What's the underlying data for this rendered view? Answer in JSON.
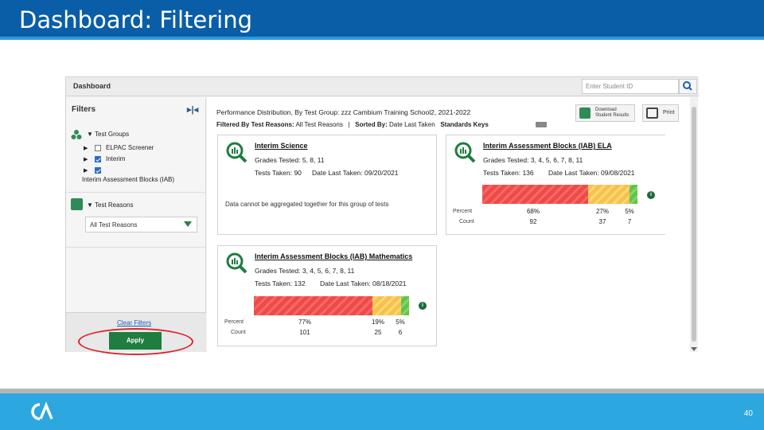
{
  "slide": {
    "title": "Dashboard: Filtering",
    "page_number": "40",
    "colors": {
      "header": "#0a5ea8",
      "footer": "#2ca7e0",
      "apply": "#1e7d3f",
      "highlight": "#d8272c"
    }
  },
  "app": {
    "title": "Dashboard",
    "search_placeholder": "Enter Student ID",
    "search_icon": "search-icon"
  },
  "filters": {
    "label": "Filters",
    "test_groups_label": "Test Groups",
    "groups": [
      {
        "label": "ELPAC Screener",
        "checked": false
      },
      {
        "label": "Interim",
        "checked": true
      },
      {
        "label": "",
        "checked": true
      }
    ],
    "iab_label": "Interim Assessment Blocks (IAB)",
    "test_reasons_label": "Test Reasons",
    "test_reasons_value": "All Test Reasons",
    "clear_link": "Clear Filters",
    "apply_button": "Apply"
  },
  "main": {
    "title": "Performance Distribution, By Test Group: zzz Cambium Training School2, 2021-2022",
    "filtered_by_label": "Filtered By Test Reasons:",
    "filtered_by_value": "All Test Reasons",
    "separator": "|",
    "sorted_by_label": "Sorted By:",
    "sorted_by_value": "Date Last Taken",
    "standards_keys": "Standards Keys",
    "download_line1": "Download",
    "download_line2": "Student Results",
    "print": "Print"
  },
  "cards": [
    {
      "title": "Interim Science",
      "grades": "Grades Tested: 5, 8, 11",
      "tests_taken": "Tests Taken: 90",
      "date_last": "Date Last Taken: 09/20/2021",
      "message": "Data cannot be aggregated together for this group of tests"
    },
    {
      "title": "Interim Assessment Blocks (IAB) ELA",
      "grades": "Grades Tested: 3, 4, 5, 6, 7, 8, 11",
      "tests_taken": "Tests Taken: 136",
      "date_last": "Date Last Taken: 09/08/2021",
      "percent_label": "Percent",
      "count_label": "Count",
      "distribution": [
        {
          "percent": "68%",
          "count": "92",
          "share": 0.68
        },
        {
          "percent": "27%",
          "count": "37",
          "share": 0.27
        },
        {
          "percent": "5%",
          "count": "7",
          "share": 0.05
        }
      ]
    },
    {
      "title": "Interim Assessment Blocks (IAB) Mathematics",
      "grades": "Grades Tested: 3, 4, 5, 6, 7, 8, 11",
      "tests_taken": "Tests Taken: 132",
      "date_last": "Date Last Taken: 08/18/2021",
      "percent_label": "Percent",
      "count_label": "Count",
      "distribution": [
        {
          "percent": "77%",
          "count": "101",
          "share": 0.77
        },
        {
          "percent": "19%",
          "count": "25",
          "share": 0.19
        },
        {
          "percent": "5%",
          "count": "6",
          "share": 0.05
        }
      ]
    }
  ]
}
